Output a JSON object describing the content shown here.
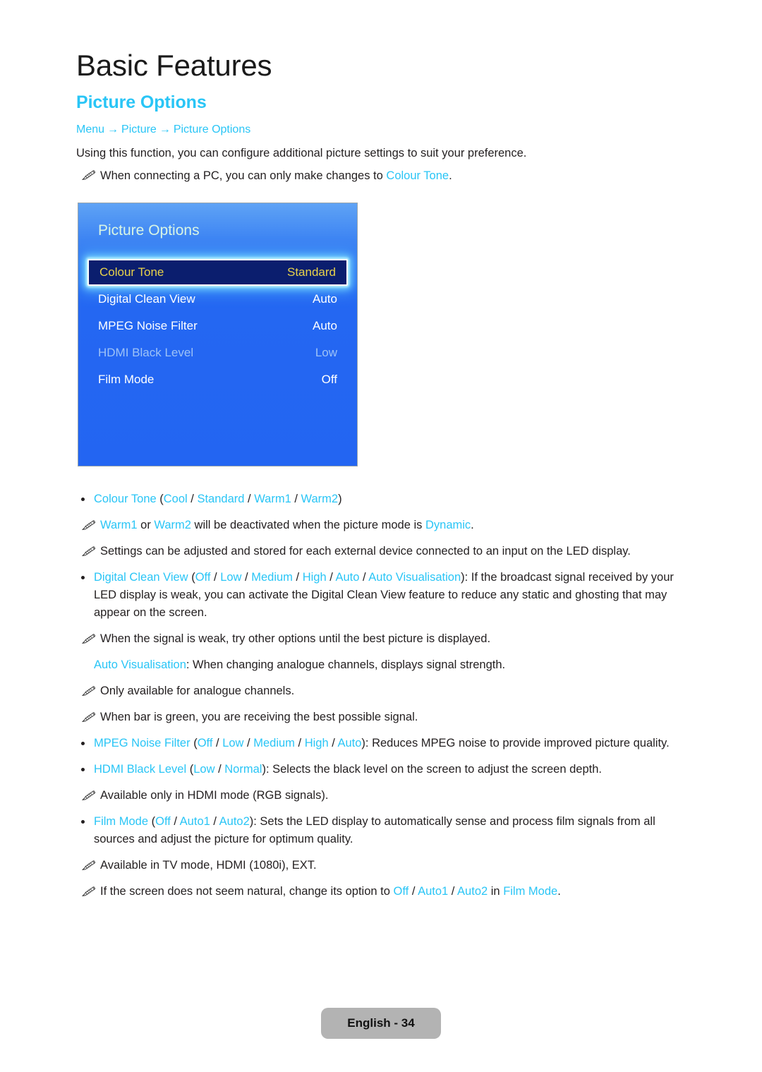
{
  "page": {
    "chapter_title": "Basic Features",
    "section_title": "Picture Options",
    "footer_label": "English - 34",
    "accent_color": "#29c5f6",
    "panel_blue": "#2365f2",
    "selected_row_bg": "#0b1e6e",
    "selected_row_text": "#e8d24a",
    "footer_pill_bg": "#b3b3b3"
  },
  "breadcrumb": {
    "items": [
      "Menu",
      "Picture",
      "Picture Options"
    ],
    "separator": "→"
  },
  "intro": {
    "text": "Using this function, you can configure additional picture settings to suit your preference.",
    "note_pre": "When connecting a PC, you can only make changes to ",
    "note_link": "Colour Tone",
    "note_post": "."
  },
  "osd": {
    "title": "Picture Options",
    "rows": [
      {
        "label": "Colour Tone",
        "value": "Standard",
        "state": "selected"
      },
      {
        "label": "Digital Clean View",
        "value": "Auto",
        "state": "normal"
      },
      {
        "label": "MPEG Noise Filter",
        "value": "Auto",
        "state": "normal"
      },
      {
        "label": "HDMI Black Level",
        "value": "Low",
        "state": "disabled"
      },
      {
        "label": "Film Mode",
        "value": "Off",
        "state": "normal"
      }
    ]
  },
  "body": {
    "b1_name": "Colour Tone",
    "b1_open": " (",
    "b1_o1": "Cool",
    "b1_s1": " / ",
    "b1_o2": "Standard",
    "b1_s2": " / ",
    "b1_o3": "Warm1",
    "b1_s3": " / ",
    "b1_o4": "Warm2",
    "b1_close": ")",
    "n1_a": "Warm1",
    "n1_b": " or ",
    "n1_c": "Warm2",
    "n1_d": " will be deactivated when the picture mode is ",
    "n1_e": "Dynamic",
    "n1_f": ".",
    "n2": "Settings can be adjusted and stored for each external device connected to an input on the LED display.",
    "b2_name": "Digital Clean View",
    "b2_open": " (",
    "b2_o1": "Off",
    "b2_o2": "Low",
    "b2_o3": "Medium",
    "b2_o4": "High",
    "b2_o5": "Auto",
    "b2_o6": "Auto Visualisation",
    "b2_sep": " / ",
    "b2_close": "): If the broadcast signal received by your LED display is weak, you can activate the Digital Clean View feature to reduce any static and ghosting that may appear on the screen.",
    "n3": "When the signal is weak, try other options until the best picture is displayed.",
    "p1_name": "Auto Visualisation",
    "p1_rest": ": When changing analogue channels, displays signal strength.",
    "n4": "Only available for analogue channels.",
    "n5": "When bar is green, you are receiving the best possible signal.",
    "b3_name": "MPEG Noise Filter",
    "b3_open": " (",
    "b3_o1": "Off",
    "b3_o2": "Low",
    "b3_o3": "Medium",
    "b3_o4": "High",
    "b3_o5": "Auto",
    "b3_sep": " / ",
    "b3_close": "): Reduces MPEG noise to provide improved picture quality.",
    "b4_name": "HDMI Black Level",
    "b4_open": " (",
    "b4_o1": "Low",
    "b4_sep": " / ",
    "b4_o2": "Normal",
    "b4_close": "): Selects the black level on the screen to adjust the screen depth.",
    "n6": "Available only in HDMI mode (RGB signals).",
    "b5_name": "Film Mode",
    "b5_open": " (",
    "b5_o1": "Off",
    "b5_o2": "Auto1",
    "b5_o3": "Auto2",
    "b5_sep": " / ",
    "b5_close": "): Sets the LED display to automatically sense and process film signals from all sources and adjust the picture for optimum quality.",
    "n7": "Available in TV mode, HDMI (1080i), EXT.",
    "n8_a": "If the screen does not seem natural, change its option to ",
    "n8_o1": "Off",
    "n8_s1": " / ",
    "n8_o2": "Auto1",
    "n8_s2": " / ",
    "n8_o3": "Auto2",
    "n8_b": " in ",
    "n8_o4": "Film Mode",
    "n8_c": "."
  }
}
